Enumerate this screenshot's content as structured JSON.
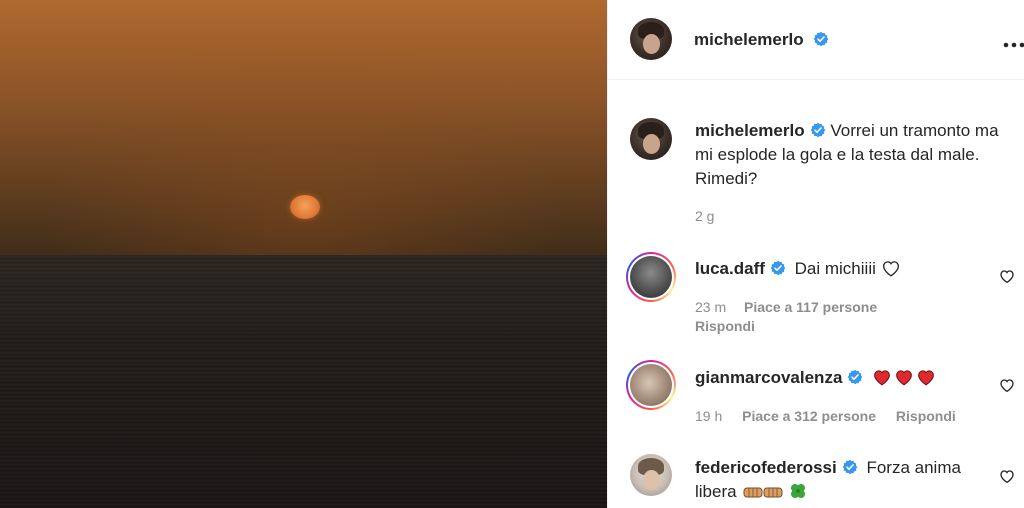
{
  "post": {
    "author": "michelemerlo",
    "caption": "Vorrei un tramonto ma mi esplode la gola e la testa dal male. Rimedi?",
    "age": "2 g"
  },
  "header": {
    "username": "michelemerlo",
    "more_icon": "more-horizontal-icon"
  },
  "comments": [
    {
      "username": "luca.daff",
      "text": "Dai michiiii",
      "emoji": "white-heart",
      "time": "23 m",
      "likes": "Piace a 117 persone",
      "reply": "Rispondi"
    },
    {
      "username": "gianmarcovalenza",
      "text": "",
      "emoji": "red-heart-x3",
      "time": "19 h",
      "likes": "Piace a 312 persone",
      "reply": "Rispondi"
    },
    {
      "username": "federicofederossi",
      "text": "Forza anima libera",
      "emoji": "fist-bumps-and-clover",
      "time": "",
      "likes": "",
      "reply": ""
    }
  ],
  "colors": {
    "verified_blue": "#3897f0",
    "text": "#262626",
    "muted": "#8e8e8e",
    "heart_red": "#ed4956"
  }
}
